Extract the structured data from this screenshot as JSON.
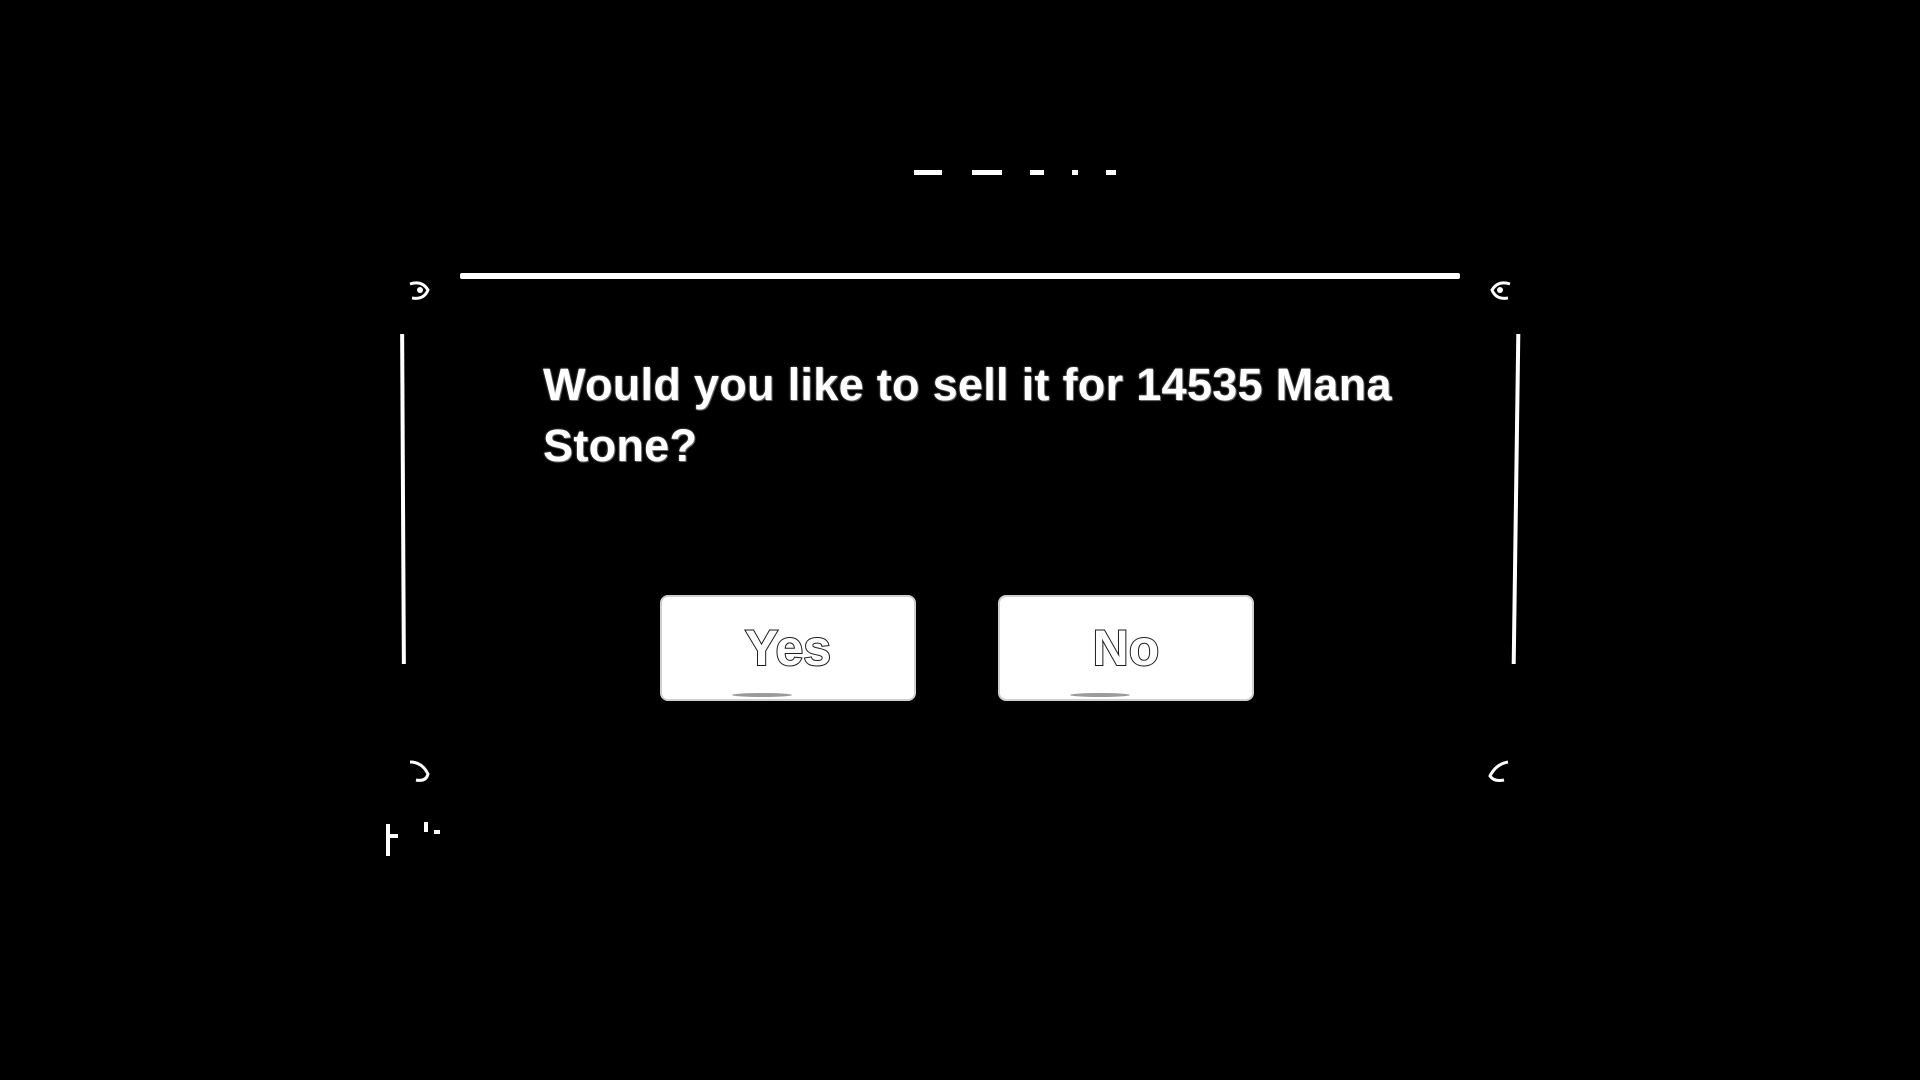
{
  "dialog": {
    "message": "Would you like to sell it for 14535 Mana Stone?",
    "buttons": {
      "yes_label": "Yes",
      "no_label": "No"
    }
  },
  "colors": {
    "background": "#000000",
    "foreground": "#ffffff",
    "text_outline": "#222222"
  },
  "icons": {
    "corner": "ornament-corner-icon"
  }
}
